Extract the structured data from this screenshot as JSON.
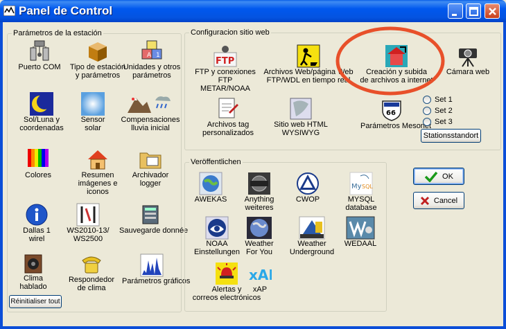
{
  "window": {
    "title": "Panel de Control"
  },
  "station": {
    "title": "Parámetros de la estación",
    "items": [
      {
        "label": "Puerto COM"
      },
      {
        "label": "Tipo de estación\ny parámetros"
      },
      {
        "label": "Unidades y otros\nparámetros"
      },
      {
        "label": "Sol/Luna y\ncoordenadas"
      },
      {
        "label": "Sensor\nsolar"
      },
      {
        "label": "Compensaciones\nlluvia inicial"
      },
      {
        "label": "Colores"
      },
      {
        "label": "Resumen\nimágenes e iconos"
      },
      {
        "label": "Archivador\nlogger"
      },
      {
        "label": "Dallas 1\nwirel"
      },
      {
        "label": "WS2010-13/\nWS2500"
      },
      {
        "label": "Sauvegarde donnée"
      },
      {
        "label": "Clima\nhablado"
      },
      {
        "label": "Respondedor\nde clima"
      },
      {
        "label": "Parámetros gráficos"
      }
    ],
    "reset_button": "Réinitialiser tout"
  },
  "website": {
    "title": "Configuracion sitio web",
    "items": [
      {
        "label": "FTP y conexiones\nFTP METAR/NOAA"
      },
      {
        "label": "Archivos Web/página Web\nFTP/WDL en tiempo real"
      },
      {
        "label": "Creación y subida\nde archivos a internet"
      },
      {
        "label": "Cámara web"
      },
      {
        "label": "Archivos tag\npersonalizados"
      },
      {
        "label": "Sitio web HTML\nWYSIWYG"
      },
      {
        "label": "Parámetros Mesonet"
      }
    ],
    "sets": [
      "Set 1",
      "Set 2",
      "Set 3"
    ],
    "stations_button": "Stationsstandort"
  },
  "publish": {
    "title": "Veröffentlichen",
    "items": [
      {
        "label": "AWEKAS"
      },
      {
        "label": "Anything\nweiteres"
      },
      {
        "label": "CWOP"
      },
      {
        "label": "MYSQL\ndatabase"
      },
      {
        "label": "NOAA\nEinstellungen"
      },
      {
        "label": "Weather\nFor You"
      },
      {
        "label": "Weather\nUnderground"
      },
      {
        "label": "WEDAAL"
      },
      {
        "label": "Alertas y\ncorreos electrónicos"
      },
      {
        "label": "xAP"
      }
    ]
  },
  "actions": {
    "ok": "OK",
    "cancel": "Cancel"
  },
  "colors": {
    "titlebar": "#0054E3",
    "highlight": "#E8502A",
    "background": "#ECE9D8"
  }
}
